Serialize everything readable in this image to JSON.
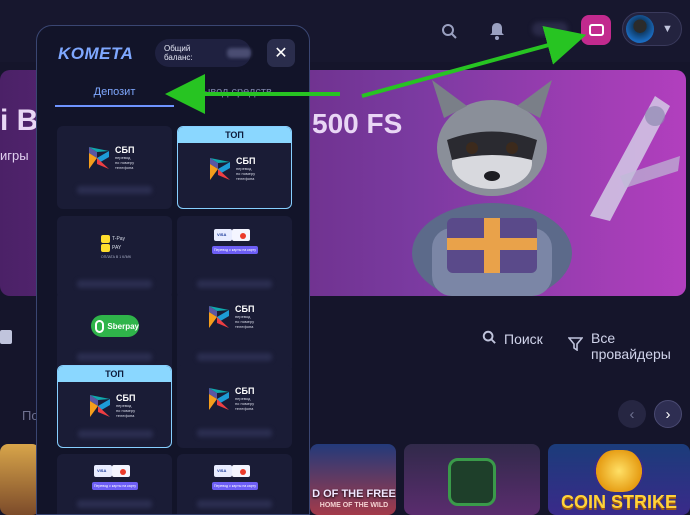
{
  "header": {
    "icons": [
      "search-icon",
      "bell-icon",
      "wallet-icon",
      "chevron-down-icon"
    ],
    "accent": "#c22a8e"
  },
  "banner": {
    "headline_fragment": "i Bo",
    "fs_text": "500 FS",
    "sub_fragment": "игры"
  },
  "filters": {
    "search_label": "Поиск",
    "providers_label": "Все провайдеры"
  },
  "section": {
    "label_fragment": "По"
  },
  "games": {
    "tile2_title": "D OF THE FREE",
    "tile2_sub": "HOME OF THE WILD",
    "tile4_title": "COIN STRIKE"
  },
  "modal": {
    "logo": "KOMETA",
    "balance_label": "Общий баланс:",
    "close_glyph": "✕",
    "tabs": {
      "deposit": "Депозит",
      "withdraw": "Вывод средств"
    },
    "top_label": "ТОП",
    "sbp": {
      "title": "СБП",
      "sub_line1": "перевод",
      "sub_line2": "по номеру",
      "sub_line3": "телефона"
    },
    "transfer_label": "Перевод с карты на карту",
    "tpay": {
      "line1": "T-Pay",
      "line2": "PAY",
      "caption": "ОПЛАТА В 1 КЛИК"
    },
    "sberpay": "Sberpay"
  },
  "colors": {
    "modal_bg": "#121429",
    "accent_blue": "#7fa8ff",
    "top_badge": "#8ad7ff",
    "arrow": "#27c422"
  }
}
